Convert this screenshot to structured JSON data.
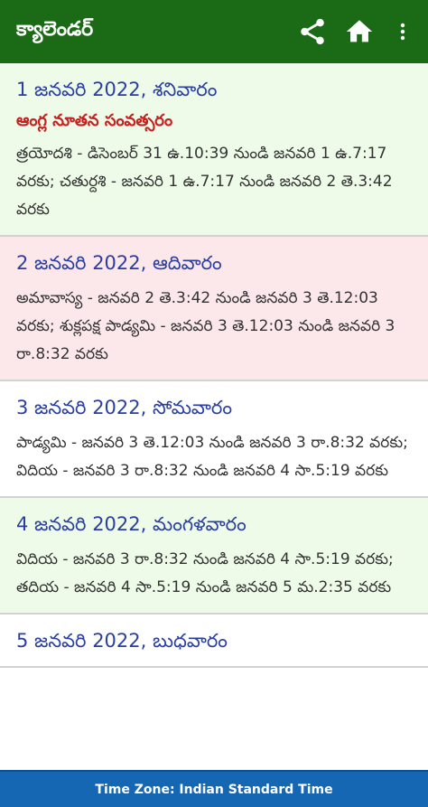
{
  "appbar": {
    "title": "క్యాలెండర్",
    "icons": [
      "share-icon",
      "home-icon",
      "more-vert-icon"
    ]
  },
  "days": [
    {
      "date": "1 జనవరి 2022, శనివారం",
      "festival": "ఆంగ్ల నూతన సంవత్సరం",
      "detail": "త్రయోదశి - డిసెంబర్ 31 ఉ.10:39 నుండి జనవరి 1 ఉ.7:17 వరకు; చతుర్దశి - జనవరి 1 ఉ.7:17 నుండి జనవరి 2 తె.3:42 వరకు"
    },
    {
      "date": "2 జనవరి 2022, ఆదివారం",
      "detail": "అమావాస్య - జనవరి 2 తె.3:42 నుండి జనవరి 3 తె.12:03 వరకు; శుక్లపక్ష పాడ్యమి - జనవరి 3 తె.12:03 నుండి జనవరి 3 రా.8:32 వరకు"
    },
    {
      "date": "3 జనవరి 2022, సోమవారం",
      "detail": "పాడ్యమి - జనవరి 3 తె.12:03 నుండి జనవరి 3 రా.8:32 వరకు; విదియ - జనవరి 3 రా.8:32 నుండి జనవరి 4 సా.5:19 వరకు"
    },
    {
      "date": "4 జనవరి 2022, మంగళవారం",
      "detail": "విదియ - జనవరి 3 రా.8:32 నుండి జనవరి 4 సా.5:19 వరకు; తదియ - జనవరి 4 సా.5:19 నుండి జనవరి 5 మ.2:35 వరకు"
    },
    {
      "date": "5 జనవరి 2022, బుధవారం"
    }
  ],
  "footer": {
    "timezone": "Time Zone: Indian Standard Time"
  },
  "colors": {
    "appbar": "#1b6b16",
    "footer": "#1566b3",
    "date_text": "#2a3fa0",
    "festival_text": "#c62020",
    "row_green": "#eefbe8",
    "row_pink": "#fce8ea"
  }
}
